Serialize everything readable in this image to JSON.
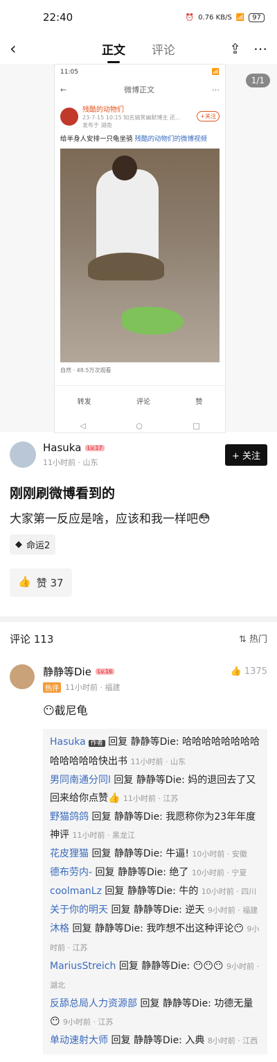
{
  "status": {
    "time": "22:40",
    "net": "0.76 KB/S",
    "battery": "97"
  },
  "tabs": {
    "active": "正文",
    "other": "评论"
  },
  "image": {
    "page_badge": "1/1",
    "status_time": "11:05",
    "header_title": "微博正文",
    "author": "残酷的动物们",
    "meta": "23-7-15 10:15 知名搞笑幽默博主 还...",
    "meta2": "发布于 湖南",
    "follow": "+关注",
    "text_line1": "给半身人安排一只龟坐骑",
    "text_link": "残酷的动物们的微博视频",
    "info": "自然 · 48.5万次观看",
    "actions": [
      "转发",
      "评论",
      "赞"
    ]
  },
  "post": {
    "author": "Hasuka",
    "level": "Lv.17",
    "time_loc": "11小时前 · 山东",
    "follow_label": "+ 关注",
    "title": "刚刚刷微博看到的",
    "body": "大家第一反应是啥，应该和我一样吧😳",
    "tag": "命运2",
    "like_label": "赞 37"
  },
  "comments": {
    "header": "评论 113",
    "sort": "热门",
    "top": {
      "name": "静静等Die",
      "level": "Lv.16",
      "hot": "热评",
      "meta": "11小时前 · 福建",
      "likes": "1375",
      "text": "😶截尼龟"
    },
    "replies": [
      {
        "name": "Hasuka",
        "badge": "作者",
        "text": "回复 静静等Die: 哈哈哈哈哈哈哈哈哈哈哈哈哈快出书",
        "meta": "11小时前 · 山东"
      },
      {
        "name": "男同南通分同l",
        "badge": "",
        "text": "回复 静静等Die: 妈的退回去了又回来给你点赞👍",
        "meta": "11小时前 · 江苏"
      },
      {
        "name": "野猫鸽鸽",
        "badge": "",
        "text": "回复 静静等Die: 我愿称你为23年年度神评",
        "meta": "11小时前 · 黑龙江"
      },
      {
        "name": "花皮狸猫",
        "badge": "",
        "text": "回复 静静等Die: 牛逼!",
        "meta": "10小时前 · 安徽"
      },
      {
        "name": "德布劳内-",
        "badge": "",
        "text": "回复 静静等Die: 绝了",
        "meta": "10小时前 · 宁夏"
      },
      {
        "name": "coolmanLz",
        "badge": "",
        "text": "回复 静静等Die: 牛的",
        "meta": "10小时前 · 四川"
      },
      {
        "name": "关于你的明天",
        "badge": "",
        "text": "回复 静静等Die: 逆天",
        "meta": "9小时前 · 福建"
      },
      {
        "name": "沐格",
        "badge": "",
        "text": "回复 静静等Die: 我咋想不出这种评论😶",
        "meta": "9小时前 · 江苏"
      },
      {
        "name": "MariusStreich",
        "badge": "",
        "text": "回复 静静等Die: 😶😶😶",
        "meta": "9小时前 · 湖北"
      },
      {
        "name": "反舔总局人力资源部",
        "badge": "",
        "text": "回复 静静等Die: 功德无量😶",
        "meta": "9小时前 · 江苏"
      },
      {
        "name": "单动速射大师",
        "badge": "",
        "text": "回复 静静等Die: 入典",
        "meta": "8小时前 · 江西"
      }
    ]
  }
}
